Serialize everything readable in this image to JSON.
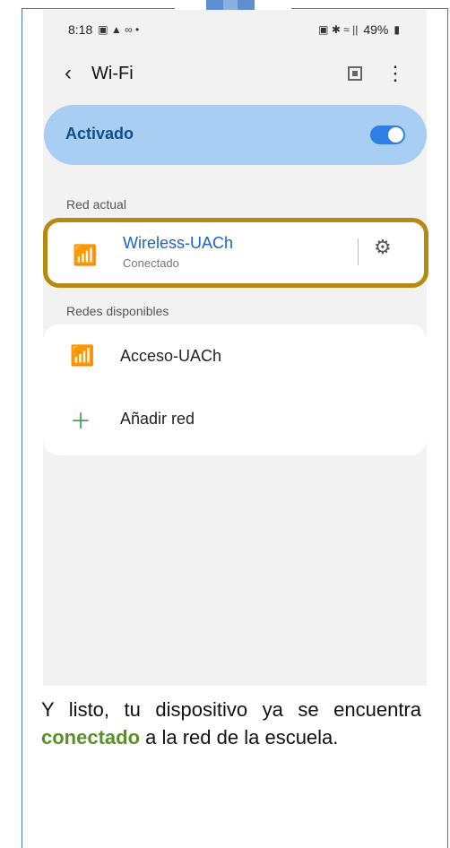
{
  "status_bar": {
    "time": "8:18",
    "left_icons": "▣ ▲ ∞ •",
    "battery": "49%",
    "right_icons": "▣ ✱ ≈ ||"
  },
  "header": {
    "title": "Wi-Fi",
    "back_icon": "chevron-left-icon",
    "qr_icon": "qr-scan-icon",
    "more_icon": "more-vertical-icon"
  },
  "master_toggle": {
    "label": "Activado",
    "state": "on"
  },
  "current_network": {
    "section_label": "Red actual",
    "name": "Wireless-UACh",
    "status": "Conectado"
  },
  "available_networks": {
    "section_label": "Redes disponibles",
    "items": [
      {
        "label": "Acceso-UACh",
        "icon": "wifi-lock-icon"
      },
      {
        "label": "Añadir red",
        "icon": "plus-icon"
      }
    ]
  },
  "caption": {
    "part1": "Y listo, tu dispositivo ya se encuentra ",
    "highlight": "conectado",
    "part2": " a la red de la escuela."
  },
  "colors": {
    "accent": "#2d7fe5",
    "highlight_border": "#b68a10",
    "caption_highlight": "#5b8f2a"
  }
}
